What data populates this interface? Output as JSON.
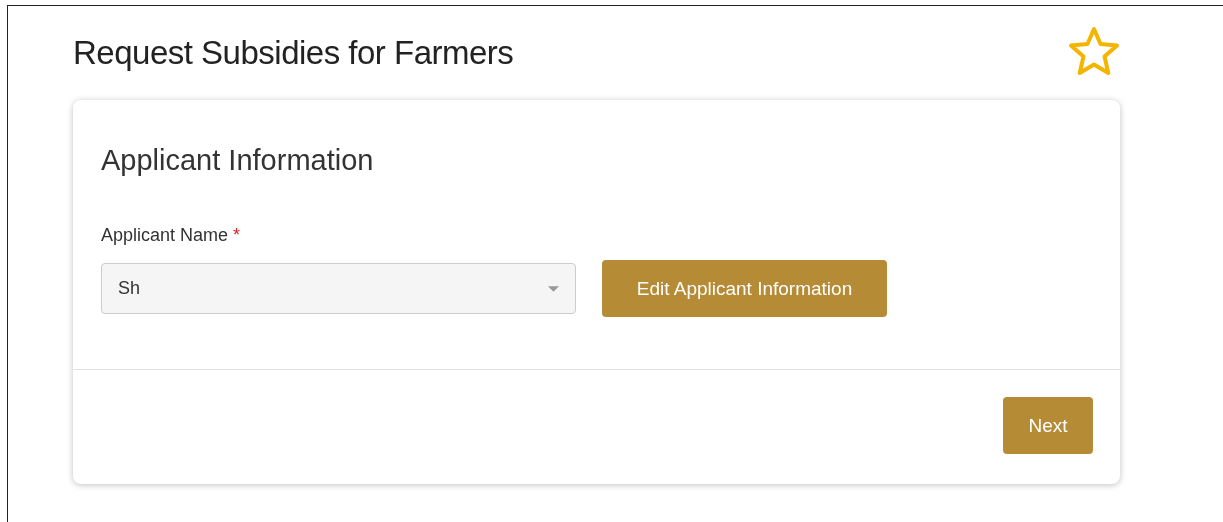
{
  "page": {
    "title": "Request Subsidies for Farmers",
    "favorite": false
  },
  "section": {
    "title": "Applicant Information"
  },
  "field": {
    "label": "Applicant Name",
    "required_mark": "*",
    "value": "Sh"
  },
  "buttons": {
    "edit": "Edit Applicant Information",
    "next": "Next"
  }
}
